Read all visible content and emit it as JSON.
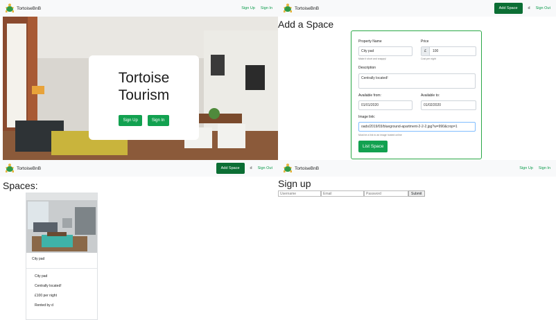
{
  "brand": "TortoiseBnB",
  "nav": {
    "sign_up": "Sign Up",
    "sign_in": "Sign In",
    "add_space": "Add Space",
    "user": "d",
    "sign_out": "Sign Out"
  },
  "home": {
    "title_line1": "Tortoise",
    "title_line2": "Tourism",
    "sign_up": "Sign Up",
    "sign_in": "Sign In"
  },
  "add_space": {
    "title": "Add a Space",
    "property_name_label": "Property Name",
    "property_name_value": "City pad",
    "property_name_help": "Make it short and snappy!",
    "price_label": "Price",
    "currency": "£",
    "price_value": "100",
    "price_help": "Cost per night",
    "description_label": "Description",
    "description_value": "Centrally located!",
    "available_from_label": "Available from:",
    "available_from_value": "01/01/2020",
    "available_to_label": "Available to:",
    "available_to_value": "01/02/2020",
    "image_link_label": "Image link:",
    "image_link_value": "oads/2019/03/blueground-apartment-2-2-2.jpg?w=990&crop=1",
    "image_link_help": "Must be a link to an image hosted online",
    "submit": "List Space"
  },
  "spaces": {
    "title": "Spaces:",
    "card_name": "City pad",
    "details": [
      "City pad",
      "Centrally located!",
      "£100 per night",
      "Rented by d"
    ]
  },
  "signup": {
    "title": "Sign up",
    "username_placeholder": "Username",
    "email_placeholder": "Email",
    "password_placeholder": "Password",
    "submit": "Submit"
  }
}
